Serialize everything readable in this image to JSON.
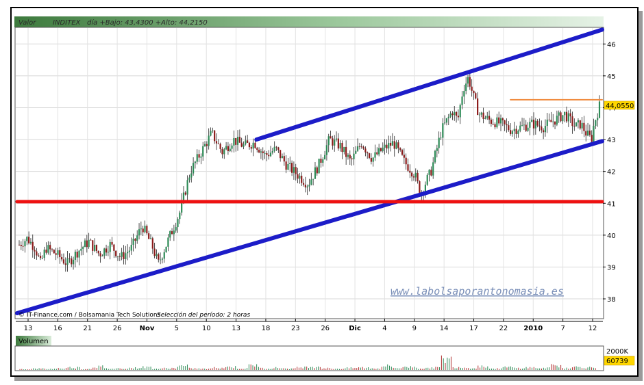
{
  "header": {
    "label_valor": "Valor",
    "ticker": "INDITEX",
    "day_info": "día +Bajo: 43,4300 +Alto: 44,2150"
  },
  "credits": {
    "source": "© IT-Finance.com / Bolsamania Tech Solutions",
    "period": "Selección del período: 2 horas"
  },
  "watermark": "www.labolsaporantonomasia.es",
  "volume": {
    "label": "Volumen",
    "scale_label": "2000K",
    "current_value": "60739"
  },
  "colors": {
    "channel": "#1c1cc8",
    "support": "#ee1111",
    "resistance": "#f08c40",
    "bull_candle": "#2e8b57",
    "bear_candle": "#8b1a1a",
    "panel_gradient_dark": "#3d7a3d",
    "panel_gradient_light": "#e6f2e6"
  },
  "chart_data": {
    "type": "candlestick",
    "title": "INDITEX",
    "y_ticks": [
      "38",
      "39",
      "40",
      "41",
      "42",
      "43",
      "44",
      "45",
      "46"
    ],
    "ylim": [
      37.4,
      46.5
    ],
    "current_price_label": "44,0550",
    "current_price": 44.055,
    "x_tick_labels": [
      "13",
      "16",
      "21",
      "26",
      "Nov",
      "5",
      "10",
      "13",
      "18",
      "23",
      "26",
      "Dic",
      "4",
      "9",
      "14",
      "17",
      "22",
      "2010",
      "7",
      "12"
    ],
    "x_tick_bold": [
      "Nov",
      "Dic",
      "2010"
    ],
    "price_path": [
      [
        0,
        39.7
      ],
      [
        3,
        39.9
      ],
      [
        6,
        39.6
      ],
      [
        8,
        39.1
      ],
      [
        10,
        39.6
      ],
      [
        14,
        39.4
      ],
      [
        18,
        39.1
      ],
      [
        22,
        39.5
      ],
      [
        26,
        39.8
      ],
      [
        30,
        39.4
      ],
      [
        34,
        39.7
      ],
      [
        38,
        39.3
      ],
      [
        42,
        39.6
      ],
      [
        46,
        40.3
      ],
      [
        50,
        39.6
      ],
      [
        52,
        39.1
      ],
      [
        56,
        39.9
      ],
      [
        60,
        40.7
      ],
      [
        64,
        42.0
      ],
      [
        68,
        42.6
      ],
      [
        72,
        43.2
      ],
      [
        76,
        42.6
      ],
      [
        80,
        43.0
      ],
      [
        84,
        42.8
      ],
      [
        88,
        42.9
      ],
      [
        92,
        42.5
      ],
      [
        96,
        42.7
      ],
      [
        100,
        42.2
      ],
      [
        104,
        41.9
      ],
      [
        108,
        41.6
      ],
      [
        112,
        42.2
      ],
      [
        116,
        43.0
      ],
      [
        120,
        42.8
      ],
      [
        124,
        42.3
      ],
      [
        128,
        42.9
      ],
      [
        132,
        42.4
      ],
      [
        136,
        42.7
      ],
      [
        140,
        42.9
      ],
      [
        144,
        42.3
      ],
      [
        148,
        41.9
      ],
      [
        150,
        41.3
      ],
      [
        154,
        42.0
      ],
      [
        158,
        43.3
      ],
      [
        162,
        43.9
      ],
      [
        164,
        43.6
      ],
      [
        166,
        44.6
      ],
      [
        168,
        44.95
      ],
      [
        170,
        44.3
      ],
      [
        172,
        43.8
      ],
      [
        176,
        43.6
      ],
      [
        180,
        43.5
      ],
      [
        184,
        43.3
      ],
      [
        188,
        43.4
      ],
      [
        192,
        43.5
      ],
      [
        196,
        43.4
      ],
      [
        200,
        43.6
      ],
      [
        204,
        43.8
      ],
      [
        208,
        43.4
      ],
      [
        210,
        43.5
      ],
      [
        212,
        43.2
      ],
      [
        214,
        43.0
      ],
      [
        215,
        43.5
      ],
      [
        217,
        44.05
      ]
    ],
    "volume_path": [
      0.08,
      0.12,
      0.1,
      0.15,
      0.22,
      0.09,
      0.3,
      0.12,
      0.14,
      0.18,
      0.25,
      0.11,
      0.16,
      0.35,
      0.14,
      0.1,
      0.2,
      0.27,
      0.13,
      0.42,
      0.15,
      0.19,
      0.12,
      0.24,
      0.31,
      0.15,
      0.11,
      0.17,
      0.21,
      0.14,
      0.36,
      0.19,
      0.28,
      0.14,
      0.22,
      0.95,
      0.26,
      0.18,
      0.33,
      0.12,
      0.24,
      0.17,
      0.21,
      0.16,
      0.38,
      0.19,
      0.27,
      0.22
    ],
    "lines": [
      {
        "name": "channel-lower",
        "from": [
          0,
          37.55
        ],
        "to": [
          217,
          42.95
        ]
      },
      {
        "name": "channel-upper",
        "from": [
          90,
          43.0
        ],
        "to": [
          217,
          46.45
        ]
      },
      {
        "name": "support-horizontal",
        "from": [
          0,
          41.05
        ],
        "to": [
          217,
          41.05
        ]
      },
      {
        "name": "resistance-horizontal",
        "from": [
          185,
          44.25
        ],
        "to": [
          217,
          44.25
        ]
      }
    ]
  }
}
